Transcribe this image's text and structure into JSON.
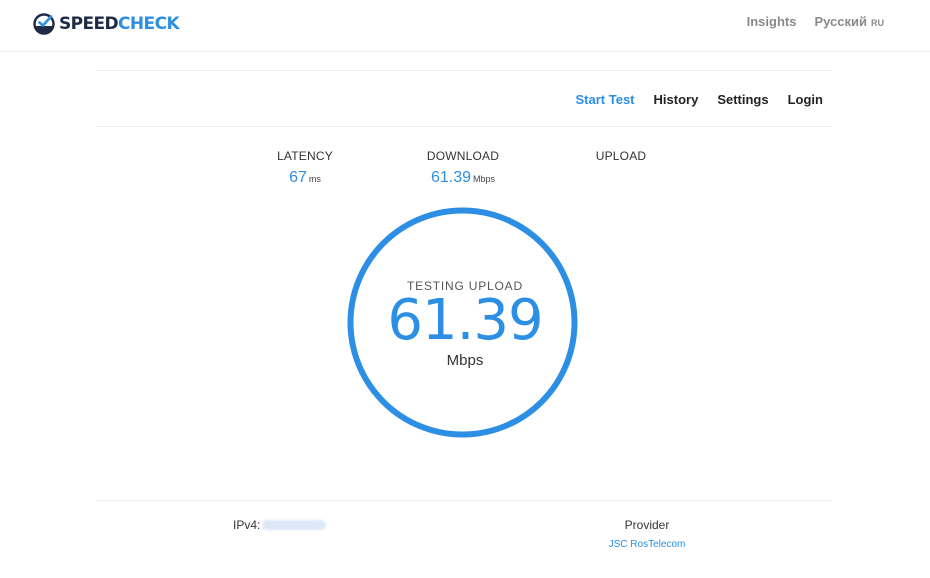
{
  "brand": {
    "speed": "SPEED",
    "check": "CHECK",
    "accent": "#2c8fe4",
    "dark": "#1f2a44"
  },
  "top_links": {
    "insights": "Insights",
    "language": "Русский",
    "language_code": "RU"
  },
  "nav": {
    "start_test": "Start Test",
    "history": "History",
    "settings": "Settings",
    "login": "Login"
  },
  "stats": {
    "latency": {
      "label": "LATENCY",
      "value": "67",
      "unit": "ms"
    },
    "download": {
      "label": "DOWNLOAD",
      "value": "61.39",
      "unit": "Mbps"
    },
    "upload": {
      "label": "UPLOAD",
      "value": "",
      "unit": ""
    }
  },
  "gauge": {
    "label": "TESTING UPLOAD",
    "value": "61.39",
    "unit": "Mbps"
  },
  "footer": {
    "ipv4_label": "IPv4:",
    "provider_label": "Provider",
    "provider_name": "JSC RosTelecom"
  }
}
